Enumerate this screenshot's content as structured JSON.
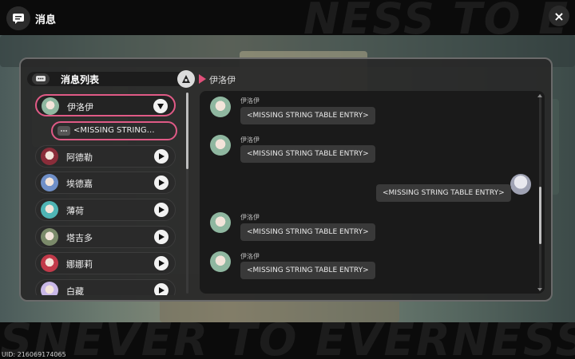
{
  "header": {
    "title": "消息",
    "close_label": "×"
  },
  "uid": "UID: 216069174065",
  "panel": {
    "list_title": "消息列表",
    "current_chat": "伊洛伊"
  },
  "contacts": [
    {
      "name": "伊洛伊",
      "expanded": true,
      "avatar_color": "#8fb7a0"
    },
    {
      "name": "阿德勒",
      "expanded": false,
      "avatar_color": "#8a2d3a"
    },
    {
      "name": "埃德嘉",
      "expanded": false,
      "avatar_color": "#6f8fc8"
    },
    {
      "name": "薄荷",
      "expanded": false,
      "avatar_color": "#4fb5b5"
    },
    {
      "name": "塔吉多",
      "expanded": false,
      "avatar_color": "#7b8a6a"
    },
    {
      "name": "娜娜莉",
      "expanded": false,
      "avatar_color": "#c23a4a"
    },
    {
      "name": "白藏",
      "expanded": false,
      "avatar_color": "#c9b8e8"
    }
  ],
  "sub_item": "<MISSING STRING…",
  "messages": [
    {
      "sender": "伊洛伊",
      "text": "<MISSING STRING TABLE ENTRY>",
      "side": "left"
    },
    {
      "sender": "伊洛伊",
      "text": "<MISSING STRING TABLE ENTRY>",
      "side": "left"
    },
    {
      "sender": "",
      "text": "<MISSING STRING TABLE ENTRY>",
      "side": "right"
    },
    {
      "sender": "伊洛伊",
      "text": "<MISSING STRING TABLE ENTRY>",
      "side": "left"
    },
    {
      "sender": "伊洛伊",
      "text": "<MISSING STRING TABLE ENTRY>",
      "side": "left"
    }
  ],
  "colors": {
    "accent": "#e05a86",
    "panel_bg": "#282828",
    "bubble_bg": "#393939"
  }
}
